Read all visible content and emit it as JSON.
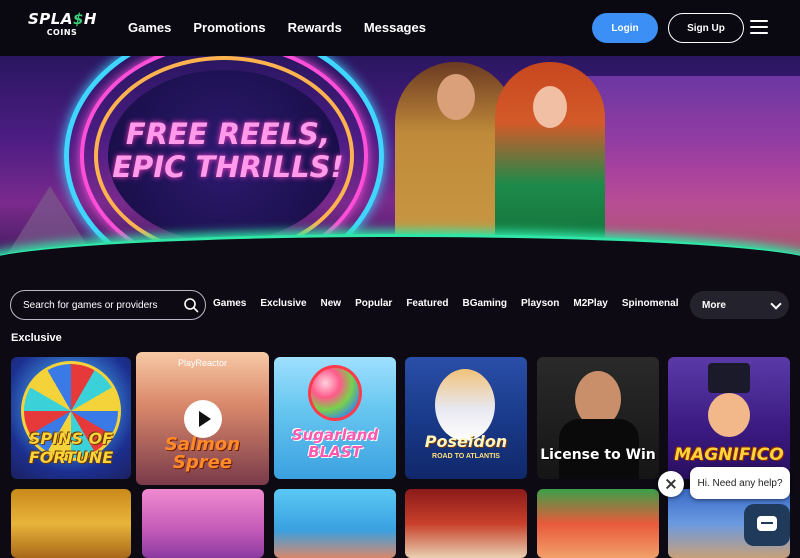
{
  "header": {
    "logo_top": "SPLA",
    "logo_dollar": "$",
    "logo_top_end": "H",
    "logo_bottom": "COINS",
    "nav": [
      {
        "label": "Games"
      },
      {
        "label": "Promotions"
      },
      {
        "label": "Rewards"
      },
      {
        "label": "Messages"
      }
    ],
    "login_label": "Login",
    "signup_label": "Sign Up",
    "menu_icon": "hamburger-icon"
  },
  "hero": {
    "headline_line1": "FREE REELS,",
    "headline_line2": "EPIC THRILLS!"
  },
  "search": {
    "placeholder": "Search for games or providers",
    "icon": "search-icon"
  },
  "filters": [
    "Games",
    "Exclusive",
    "New",
    "Popular",
    "Featured",
    "BGaming",
    "Playson",
    "M2Play",
    "Spinomenal"
  ],
  "more_label": "More",
  "section_title": "Exclusive",
  "games": [
    {
      "name_line1": "SPINS OF",
      "name_line2": "FORTUNE"
    },
    {
      "provider": "PlayReactor",
      "name_line1": "Salmon",
      "name_line2": "Spree"
    },
    {
      "name_line1": "Sugarland",
      "name_line2": "BLAST"
    },
    {
      "name_line1": "Poseidon",
      "subtitle": "ROAD TO ATLANTIS"
    },
    {
      "name_line1": "License to Win"
    },
    {
      "name_line1": "MAGNIFICO"
    }
  ],
  "chat": {
    "greeting": "Hi. Need any help?"
  },
  "colors": {
    "login": "#3b8ff5",
    "accent_green": "#3ad17a",
    "hero_pink": "#ff9bea"
  }
}
